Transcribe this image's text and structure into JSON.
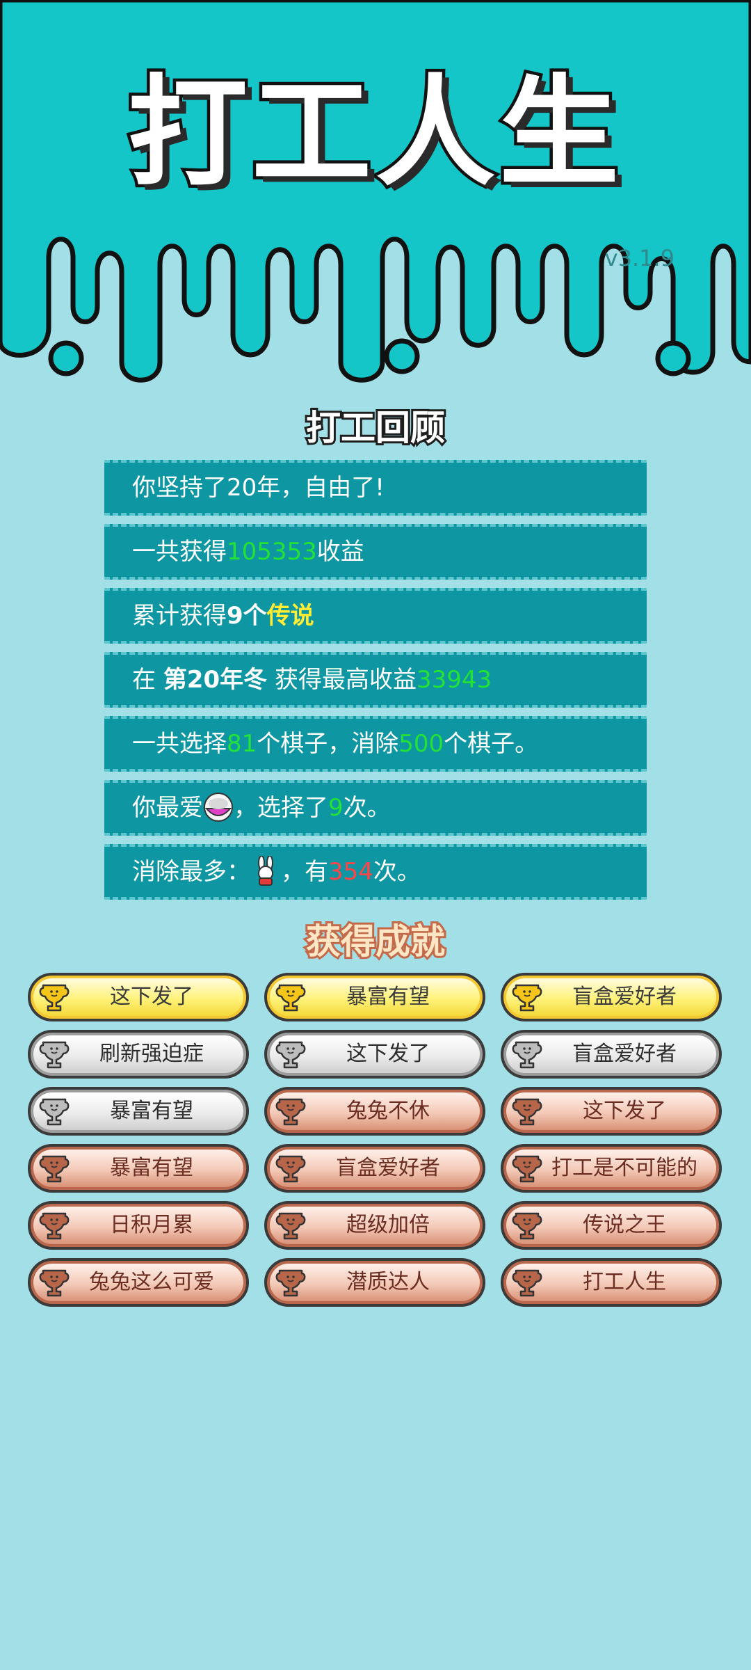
{
  "app": {
    "title": "打工人生",
    "version": "v3.1.9"
  },
  "review": {
    "title": "打工回顾",
    "rows": [
      {
        "text": "你坚持了20年，自由了!"
      },
      {
        "prefix": "一共获得",
        "value": "105353",
        "suffix": "收益"
      },
      {
        "prefix": "累计获得",
        "value": "9个",
        "highlight": "传说"
      },
      {
        "prefix": "在 ",
        "bold": "第20年冬",
        "middle": " 获得最高收益",
        "value": "33943"
      },
      {
        "p1": "一共选择",
        "v1": "81",
        "p2": "个棋子，消除",
        "v2": "500",
        "p3": "个棋子。"
      },
      {
        "prefix": "你最爱",
        "icon": "rice-bowl-icon",
        "middle": "，选择了",
        "value": "9",
        "suffix": "次。"
      },
      {
        "prefix": "消除最多：",
        "icon": "rabbit-icon",
        "middle": "，有",
        "value": "354",
        "suffix": "次。"
      }
    ]
  },
  "achievements": {
    "title": "获得成就",
    "items": [
      {
        "label": "这下发了",
        "tier": "gold"
      },
      {
        "label": "暴富有望",
        "tier": "gold"
      },
      {
        "label": "盲盒爱好者",
        "tier": "gold"
      },
      {
        "label": "刷新强迫症",
        "tier": "silver"
      },
      {
        "label": "这下发了",
        "tier": "silver"
      },
      {
        "label": "盲盒爱好者",
        "tier": "silver"
      },
      {
        "label": "暴富有望",
        "tier": "silver"
      },
      {
        "label": "兔兔不休",
        "tier": "bronze"
      },
      {
        "label": "这下发了",
        "tier": "bronze"
      },
      {
        "label": "暴富有望",
        "tier": "bronze"
      },
      {
        "label": "盲盒爱好者",
        "tier": "bronze"
      },
      {
        "label": "打工是不可能的",
        "tier": "bronze"
      },
      {
        "label": "日积月累",
        "tier": "bronze"
      },
      {
        "label": "超级加倍",
        "tier": "bronze"
      },
      {
        "label": "传说之王",
        "tier": "bronze"
      },
      {
        "label": "兔兔这么可爱",
        "tier": "bronze"
      },
      {
        "label": "潜质达人",
        "tier": "bronze"
      },
      {
        "label": "打工人生",
        "tier": "bronze"
      }
    ]
  },
  "colors": {
    "header_bg": "#14c6c8",
    "page_bg": "#a3dfe6",
    "row_bg": "#0e97a2",
    "green_value": "#22e235",
    "yellow_value": "#ffee33",
    "red_value": "#ff4545"
  }
}
